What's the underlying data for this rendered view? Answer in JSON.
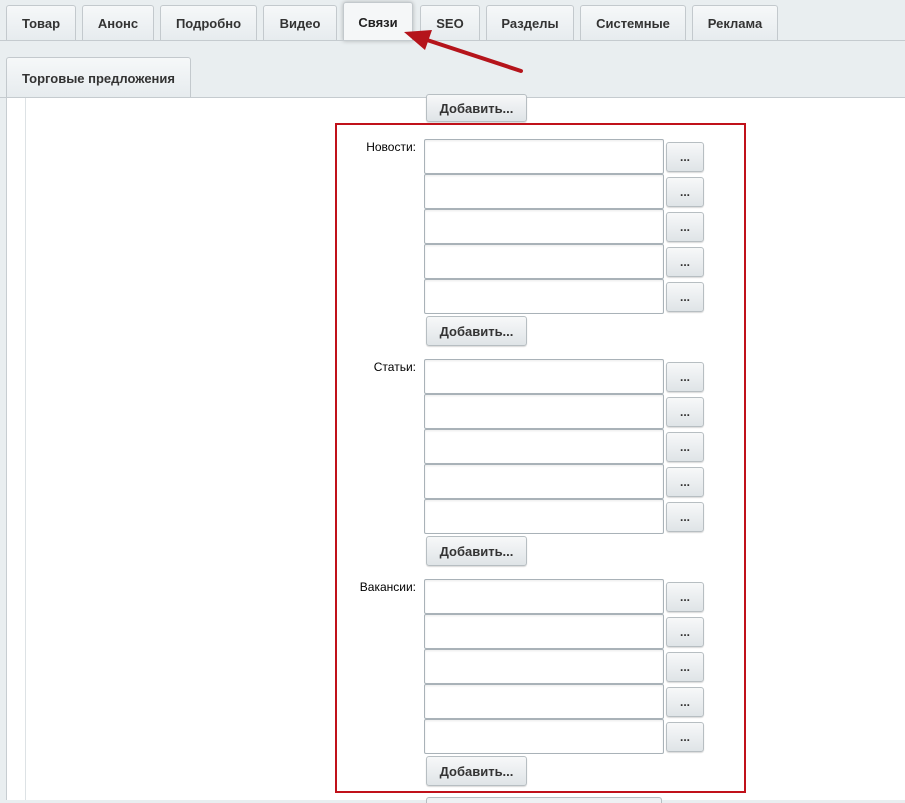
{
  "tabs_row1": [
    {
      "label": "Товар"
    },
    {
      "label": "Анонс"
    },
    {
      "label": "Подробно"
    },
    {
      "label": "Видео"
    },
    {
      "label": "Связи",
      "active": true
    },
    {
      "label": "SEO"
    },
    {
      "label": "Разделы"
    },
    {
      "label": "Системные"
    },
    {
      "label": "Реклама"
    }
  ],
  "tabs_row2": [
    {
      "label": "Торговые предложения"
    }
  ],
  "top_add_button": "Добавить...",
  "sections": [
    {
      "label": "Новости:",
      "add_label": "Добавить...",
      "dots_label": "...",
      "values": [
        "",
        "",
        "",
        "",
        ""
      ]
    },
    {
      "label": "Статьи:",
      "add_label": "Добавить...",
      "dots_label": "...",
      "values": [
        "",
        "",
        "",
        "",
        ""
      ]
    },
    {
      "label": "Вакансии:",
      "add_label": "Добавить...",
      "dots_label": "...",
      "values": [
        "",
        "",
        "",
        "",
        ""
      ]
    }
  ],
  "colors": {
    "highlight": "#c0111a",
    "arrow": "#b5141b",
    "background": "#e9eef0"
  }
}
